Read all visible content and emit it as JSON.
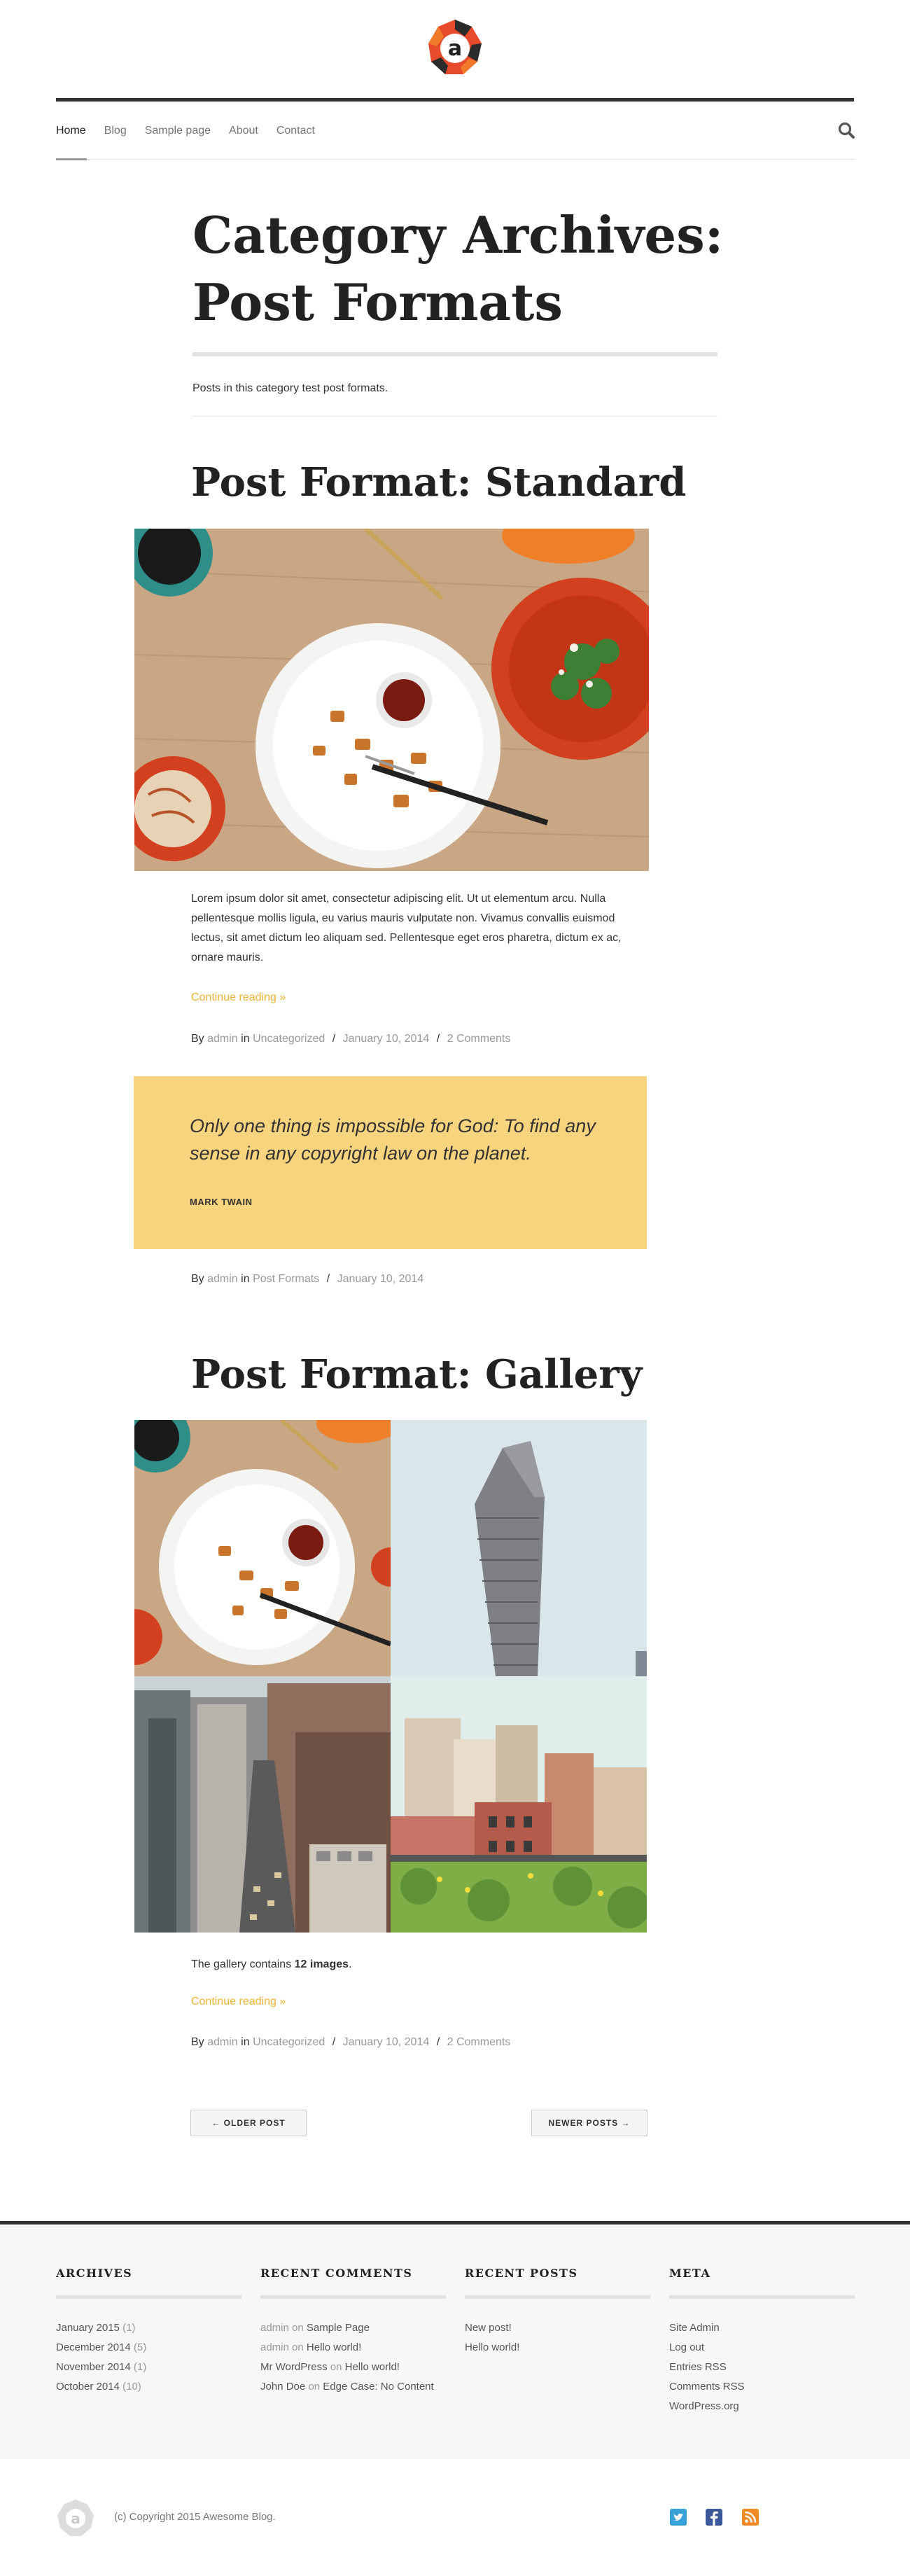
{
  "colors": {
    "accent": "#f0b435",
    "quote_bg": "#f8d47f",
    "dark_rule": "#333333",
    "footer_bg": "#f6f7f6"
  },
  "header": {
    "logo_icon": "awesome-a-logo-icon",
    "nav": [
      "Home",
      "Blog",
      "Sample page",
      "About",
      "Contact"
    ],
    "active_nav": "Home",
    "search_icon": "search-icon"
  },
  "archive": {
    "title_line1": "Category Archives:",
    "title_line2": "Post Formats",
    "description": "Posts in this category test post formats."
  },
  "posts": {
    "standard": {
      "title": "Post Format: Standard",
      "excerpt": "Lorem ipsum dolor sit amet, consectetur adipiscing elit. Ut ut elementum arcu. Nulla pellentesque mollis ligula, eu varius mauris vulputate non. Vivamus convallis euismod lectus, sit amet dictum leo aliquam sed. Pellentesque eget eros pharetra, dictum ex ac, ornare mauris.",
      "more": "Continue reading »",
      "meta": {
        "by": "By",
        "author": "admin",
        "in": "in",
        "category": "Uncategorized",
        "date": "January 10, 2014",
        "comments": "2 Comments"
      }
    },
    "quote": {
      "text": "Only one thing is impossible for God: To find any sense in any copyright law on the planet.",
      "author": "MARK TWAIN",
      "meta": {
        "by": "By",
        "author": "admin",
        "in": "in",
        "category": "Post Formats",
        "date": "January 10, 2014"
      }
    },
    "gallery": {
      "title": "Post Format: Gallery",
      "summary_prefix": "The gallery contains ",
      "summary_count": "12 images",
      "summary_suffix": ".",
      "more": "Continue reading »",
      "meta": {
        "by": "By",
        "author": "admin",
        "in": "in",
        "category": "Uncategorized",
        "date": "January 10, 2014",
        "comments": "2 Comments"
      }
    }
  },
  "pagination": {
    "older": "← OLDER POST",
    "newer": "NEWER POSTS →"
  },
  "footer": {
    "archives": {
      "title": "ARCHIVES",
      "items": [
        {
          "label": "January 2015",
          "count": "(1)"
        },
        {
          "label": "December 2014",
          "count": "(5)"
        },
        {
          "label": "November 2014",
          "count": "(1)"
        },
        {
          "label": "October 2014",
          "count": "(10)"
        }
      ]
    },
    "recent_comments": {
      "title": "RECENT COMMENTS",
      "items": [
        {
          "who": "admin",
          "on": "on",
          "post": "Sample Page"
        },
        {
          "who": "admin",
          "on": "on",
          "post": "Hello world!"
        },
        {
          "who": "Mr WordPress",
          "on": "on",
          "post": "Hello world!"
        },
        {
          "who": "John Doe",
          "on": "on",
          "post": "Edge Case: No Content"
        }
      ]
    },
    "recent_posts": {
      "title": "RECENT POSTS",
      "items": [
        "New post!",
        "Hello world!"
      ]
    },
    "meta": {
      "title": "META",
      "items": [
        "Site Admin",
        "Log out",
        "Entries RSS",
        "Comments RSS",
        "WordPress.org"
      ]
    }
  },
  "bottom": {
    "copyright": "(c) Copyright 2015 Awesome Blog.",
    "social": [
      "twitter-icon",
      "facebook-icon",
      "rss-icon"
    ]
  }
}
